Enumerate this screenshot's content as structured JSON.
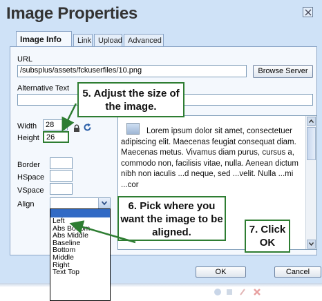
{
  "dialog": {
    "title": "Image Properties",
    "tabs": [
      {
        "label": "Image Info",
        "active": true
      },
      {
        "label": "Link",
        "active": false
      },
      {
        "label": "Upload",
        "active": false
      },
      {
        "label": "Advanced",
        "active": false
      }
    ]
  },
  "image_info": {
    "url_label": "URL",
    "url_value": "/subsplus/assets/fckuserfiles/10.png",
    "browse_button": "Browse Server",
    "alt_label": "Alternative Text",
    "alt_value": "",
    "width_label": "Width",
    "width_value": "28",
    "height_label": "Height",
    "height_value": "26",
    "border_label": "Border",
    "hspace_label": "HSpace",
    "vspace_label": "VSpace",
    "align_label": "Align",
    "align_value": ""
  },
  "align_options": [
    "",
    "Left",
    "Abs Bottom",
    "Abs Middle",
    "Baseline",
    "Bottom",
    "Middle",
    "Right",
    "Text Top"
  ],
  "preview": {
    "text": "Lorem ipsum dolor sit amet, consectetuer adipiscing elit. Maecenas feugiat consequat diam. Maecenas metus. Vivamus diam purus, cursus a, commodo non, facilisis vitae, nulla. Aenean dictum nibh non iaculis ...d neque, sed ...velit. Nulla ...mi ...cor"
  },
  "footer": {
    "ok": "OK",
    "cancel": "Cancel"
  },
  "annotations": {
    "step5": "5. Adjust the size of the image.",
    "step6": "6. Pick where you want the image to be aligned.",
    "step7": "7. Click OK"
  },
  "colors": {
    "dialog_bg": "#cfe2f7",
    "panel_bg": "#f4f8fd",
    "callout_border": "#2e7d32",
    "arrow": "#2e7d32",
    "selected_option": "#316ac5"
  }
}
